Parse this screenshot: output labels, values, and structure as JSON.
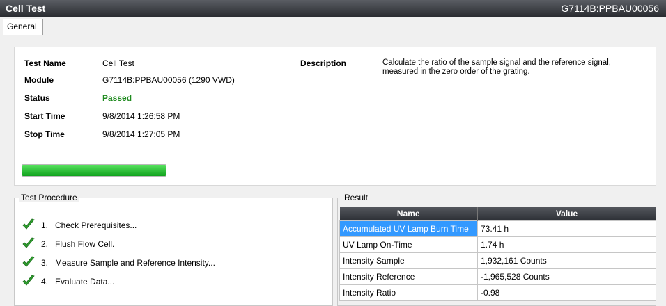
{
  "window": {
    "title": "Cell Test",
    "module_id": "G7114B:PPBAU00056"
  },
  "tabs": [
    {
      "label": "General"
    }
  ],
  "info": {
    "test_name_label": "Test Name",
    "test_name": "Cell Test",
    "module_label": "Module",
    "module": "G7114B:PPBAU00056 (1290 VWD)",
    "status_label": "Status",
    "status": "Passed",
    "start_time_label": "Start Time",
    "start_time": "9/8/2014 1:26:58 PM",
    "stop_time_label": "Stop Time",
    "stop_time": "9/8/2014 1:27:05 PM",
    "description_label": "Description",
    "description": "Calculate the ratio of the sample signal and the reference signal, measured in the zero order of the grating.",
    "progress_fraction": 1.0,
    "progress_color": "#1fb22c"
  },
  "procedure": {
    "legend": "Test Procedure",
    "steps": [
      {
        "num": "1.",
        "label": "Check Prerequisites...",
        "icon": "checkmark-icon"
      },
      {
        "num": "2.",
        "label": "Flush Flow Cell.",
        "icon": "checkmark-icon"
      },
      {
        "num": "3.",
        "label": "Measure Sample and Reference Intensity...",
        "icon": "checkmark-icon"
      },
      {
        "num": "4.",
        "label": "Evaluate Data...",
        "icon": "checkmark-icon"
      }
    ]
  },
  "result": {
    "legend": "Result",
    "columns": [
      "Name",
      "Value"
    ],
    "rows": [
      {
        "name": "Accumulated UV Lamp Burn Time",
        "value": "73.41 h",
        "selected": true
      },
      {
        "name": "UV Lamp On-Time",
        "value": "1.74 h",
        "selected": false
      },
      {
        "name": "Intensity Sample",
        "value": "1,932,161 Counts",
        "selected": false
      },
      {
        "name": "Intensity Reference",
        "value": "-1,965,528 Counts",
        "selected": false
      },
      {
        "name": "Intensity Ratio",
        "value": "-0.98",
        "selected": false
      }
    ]
  },
  "colors": {
    "status_passed": "#1e8a1e",
    "selection": "#3399ff",
    "header_dark": "#2d3036"
  }
}
